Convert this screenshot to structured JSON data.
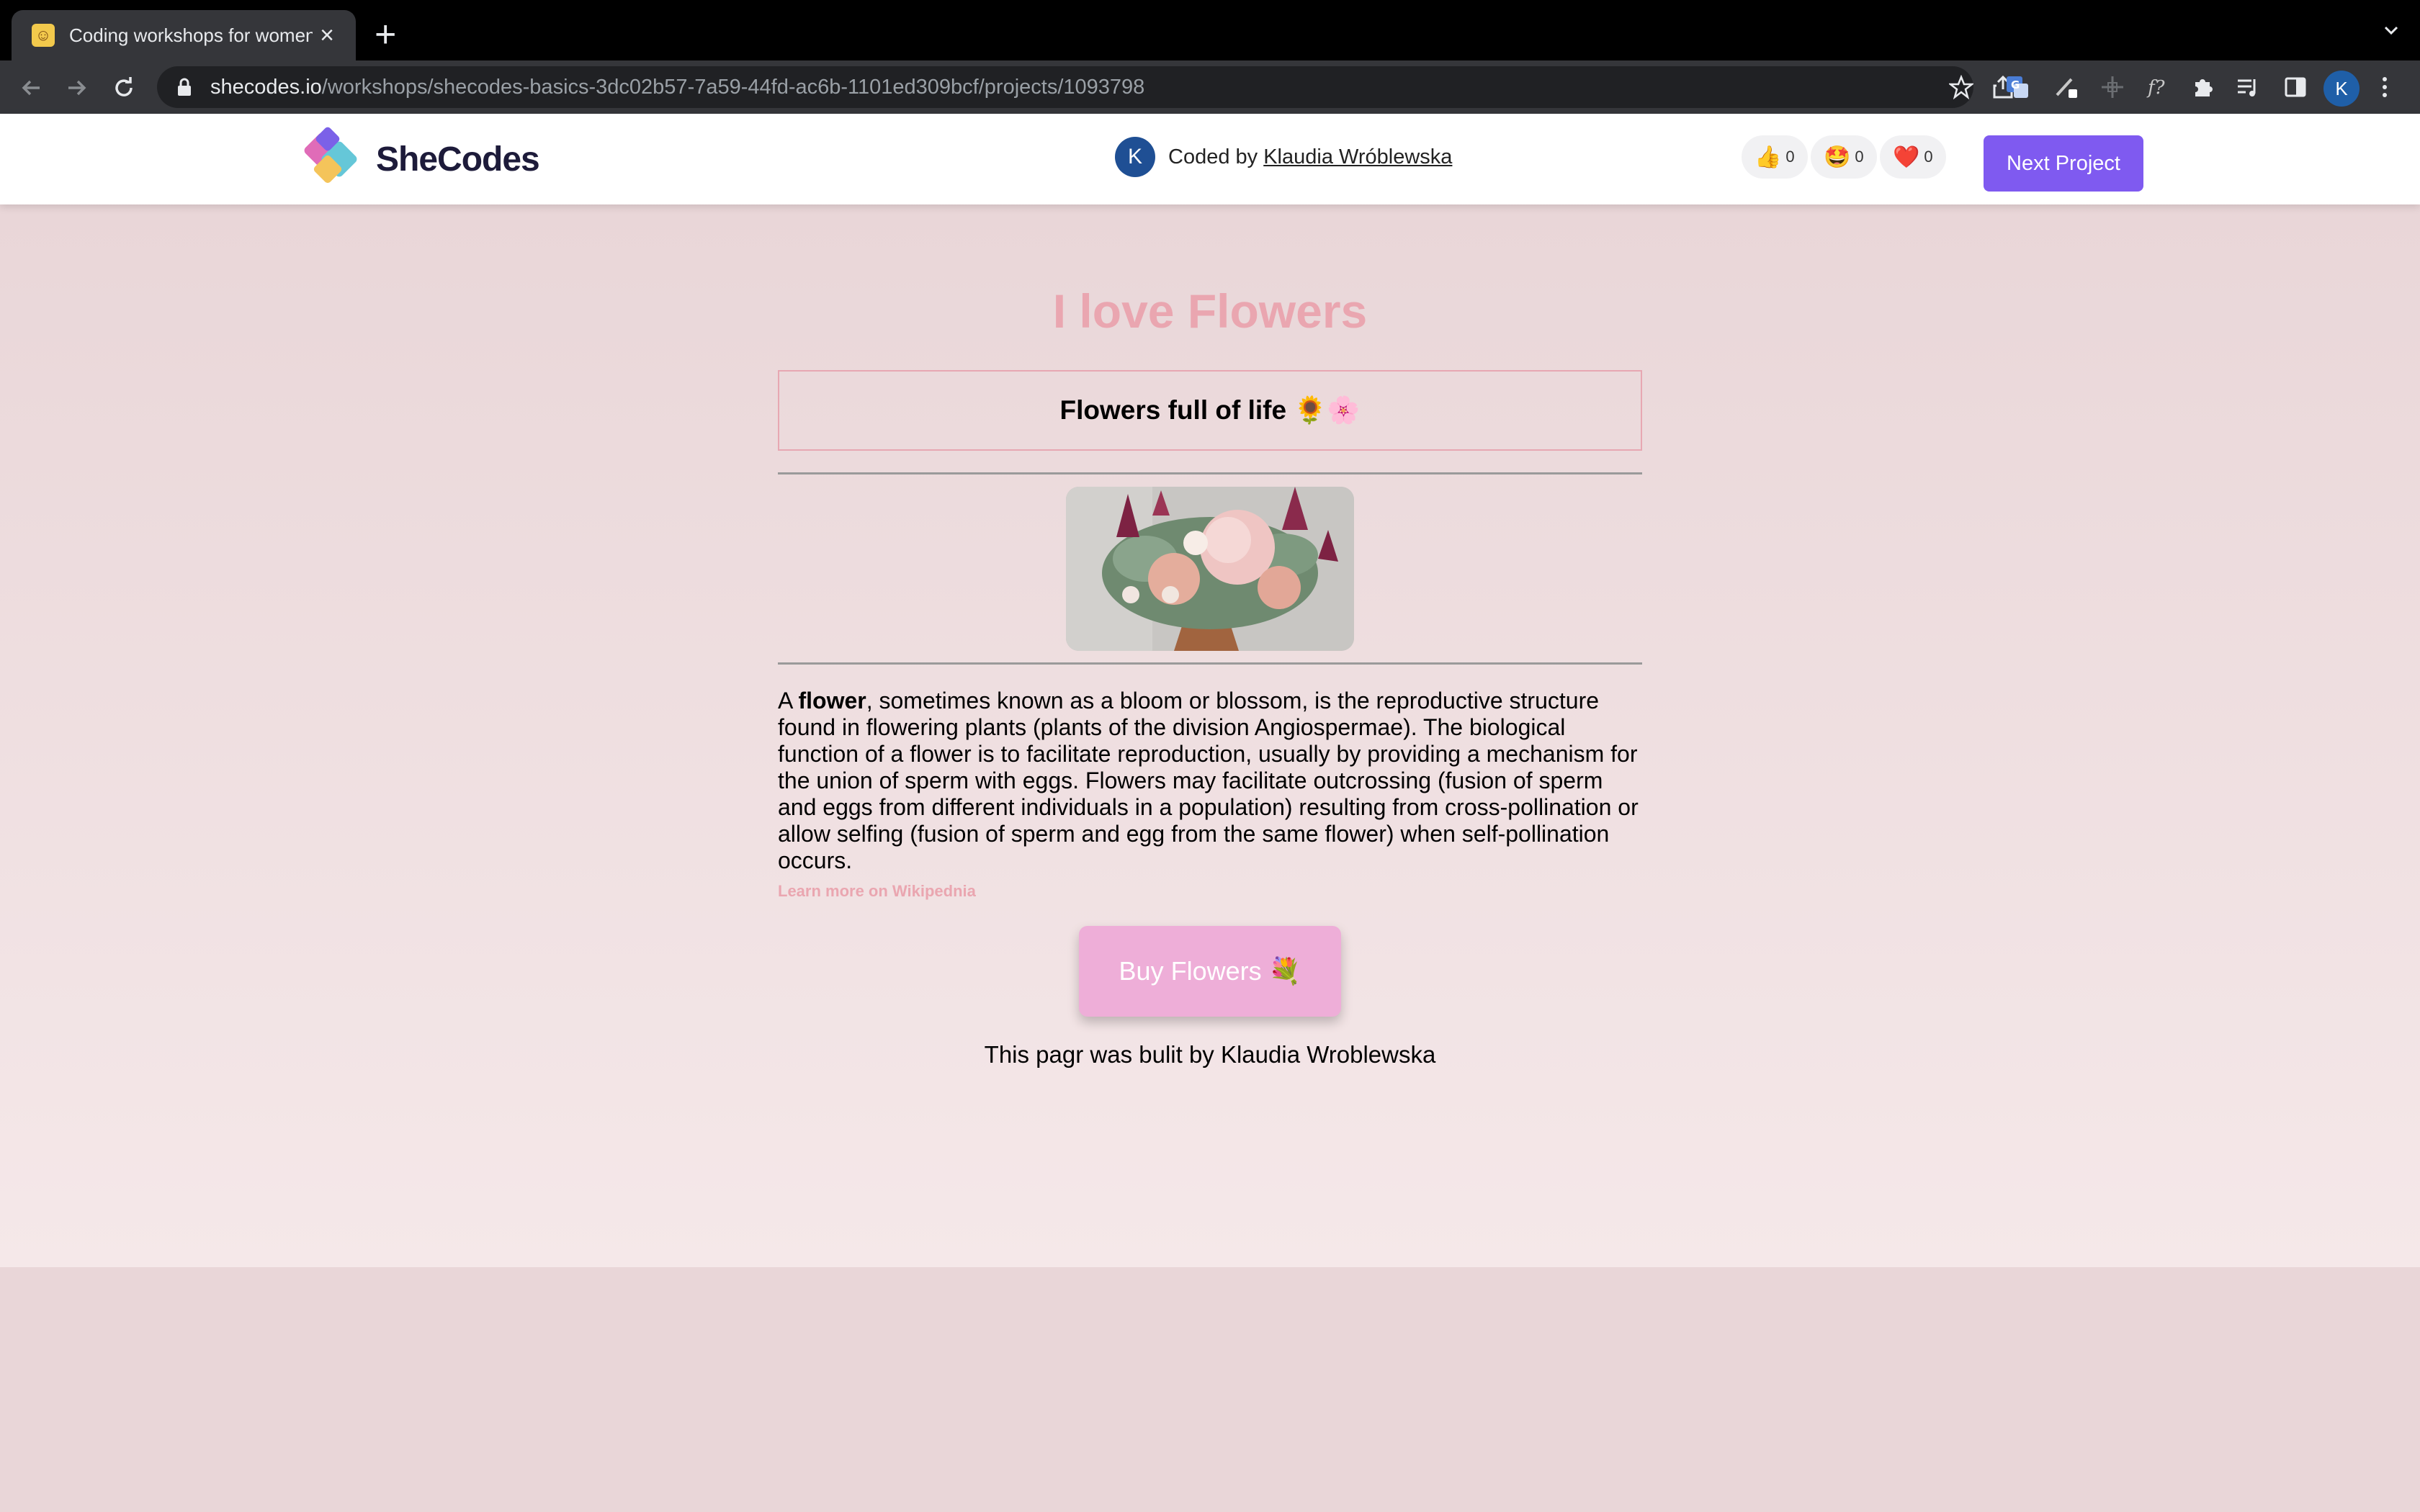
{
  "browser": {
    "tab_title": "Coding workshops for women",
    "new_tab_symbol": "+",
    "url_host": "shecodes.io",
    "url_path": "/workshops/shecodes-basics-3dc02b57-7a59-44fd-ac6b-1101ed309bcf/projects/1093798",
    "profile_initial": "K"
  },
  "header": {
    "logo_text": "SheCodes",
    "coder_initial": "K",
    "coded_by_label": "Coded by",
    "coder_name": "Klaudia Wróblewska",
    "reactions": [
      {
        "emoji": "👍",
        "count": "0"
      },
      {
        "emoji": "🤩",
        "count": "0"
      },
      {
        "emoji": "❤️",
        "count": "0"
      }
    ],
    "next_button": "Next Project"
  },
  "content": {
    "title": "I love Flowers",
    "subtitle": "Flowers full of life 🌻🌸",
    "description_prefix": "A ",
    "description_bold": "flower",
    "description_rest": ", sometimes known as a bloom or blossom, is the reproductive structure found in flowering plants (plants of the division Angiospermae). The biological function of a flower is to facilitate reproduction, usually by providing a mechanism for the union of sperm with eggs. Flowers may facilitate outcrossing (fusion of sperm and eggs from different individuals in a population) resulting from cross-pollination or allow selfing (fusion of sperm and egg from the same flower) when self-pollination occurs.",
    "wiki_link": "Learn more on Wikipednia",
    "buy_button": "Buy Flowers 💐",
    "footer": "This pagr was bulit by Klaudia Wroblewska"
  },
  "colors": {
    "page_bg": "#e9d6d8",
    "accent_pink": "#eaa6b0",
    "button_pink": "#eeaed8",
    "next_purple": "#7f5af0"
  }
}
